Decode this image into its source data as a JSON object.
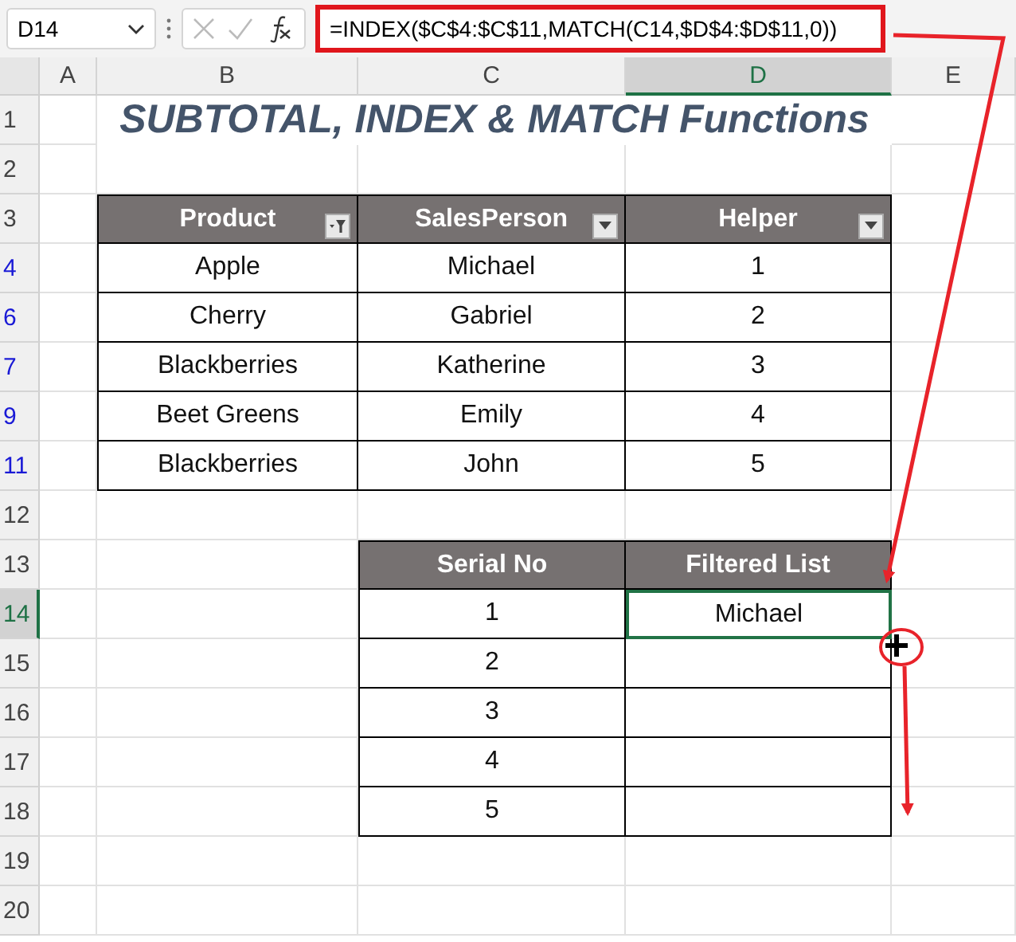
{
  "name_box": "D14",
  "formula": "=INDEX($C$4:$C$11,MATCH(C14,$D$4:$D$11,0))",
  "columns": [
    {
      "label": "A",
      "selected": false
    },
    {
      "label": "B",
      "selected": false
    },
    {
      "label": "C",
      "selected": false
    },
    {
      "label": "D",
      "selected": true
    },
    {
      "label": "E",
      "selected": false
    }
  ],
  "rows": [
    {
      "number": "1",
      "filtered": false,
      "selected": false
    },
    {
      "number": "2",
      "filtered": false,
      "selected": false
    },
    {
      "number": "3",
      "filtered": false,
      "selected": false
    },
    {
      "number": "4",
      "filtered": true,
      "selected": false
    },
    {
      "number": "6",
      "filtered": true,
      "selected": false
    },
    {
      "number": "7",
      "filtered": true,
      "selected": false
    },
    {
      "number": "9",
      "filtered": true,
      "selected": false
    },
    {
      "number": "11",
      "filtered": true,
      "selected": false
    },
    {
      "number": "12",
      "filtered": false,
      "selected": false
    },
    {
      "number": "13",
      "filtered": false,
      "selected": false
    },
    {
      "number": "14",
      "filtered": false,
      "selected": true
    },
    {
      "number": "15",
      "filtered": false,
      "selected": false
    },
    {
      "number": "16",
      "filtered": false,
      "selected": false
    },
    {
      "number": "17",
      "filtered": false,
      "selected": false
    },
    {
      "number": "18",
      "filtered": false,
      "selected": false
    },
    {
      "number": "19",
      "filtered": false,
      "selected": false
    },
    {
      "number": "20",
      "filtered": false,
      "selected": false
    }
  ],
  "title": "SUBTOTAL, INDEX & MATCH Functions",
  "table1": {
    "columns": [
      {
        "label": "Product",
        "filtered": true
      },
      {
        "label": "SalesPerson",
        "filtered": false
      },
      {
        "label": "Helper",
        "filtered": false
      }
    ],
    "rows": [
      [
        "Apple",
        "Michael",
        "1"
      ],
      [
        "Cherry",
        "Gabriel",
        "2"
      ],
      [
        "Blackberries",
        "Katherine",
        "3"
      ],
      [
        "Beet Greens",
        "Emily",
        "4"
      ],
      [
        "Blackberries",
        "John",
        "5"
      ]
    ]
  },
  "table2": {
    "columns": [
      {
        "label": "Serial No"
      },
      {
        "label": "Filtered List"
      }
    ],
    "rows": [
      {
        "cells": [
          {
            "text": "1",
            "selected": false
          },
          {
            "text": "Michael",
            "selected": true
          }
        ]
      },
      {
        "cells": [
          {
            "text": "2",
            "selected": false
          },
          {
            "selected": false
          }
        ]
      },
      {
        "cells": [
          {
            "text": "3",
            "selected": false
          },
          {
            "selected": false
          }
        ]
      },
      {
        "cells": [
          {
            "text": "4",
            "selected": false
          },
          {
            "selected": false
          }
        ]
      },
      {
        "cells": [
          {
            "text": "5",
            "selected": false
          },
          {
            "selected": false
          }
        ]
      }
    ]
  }
}
